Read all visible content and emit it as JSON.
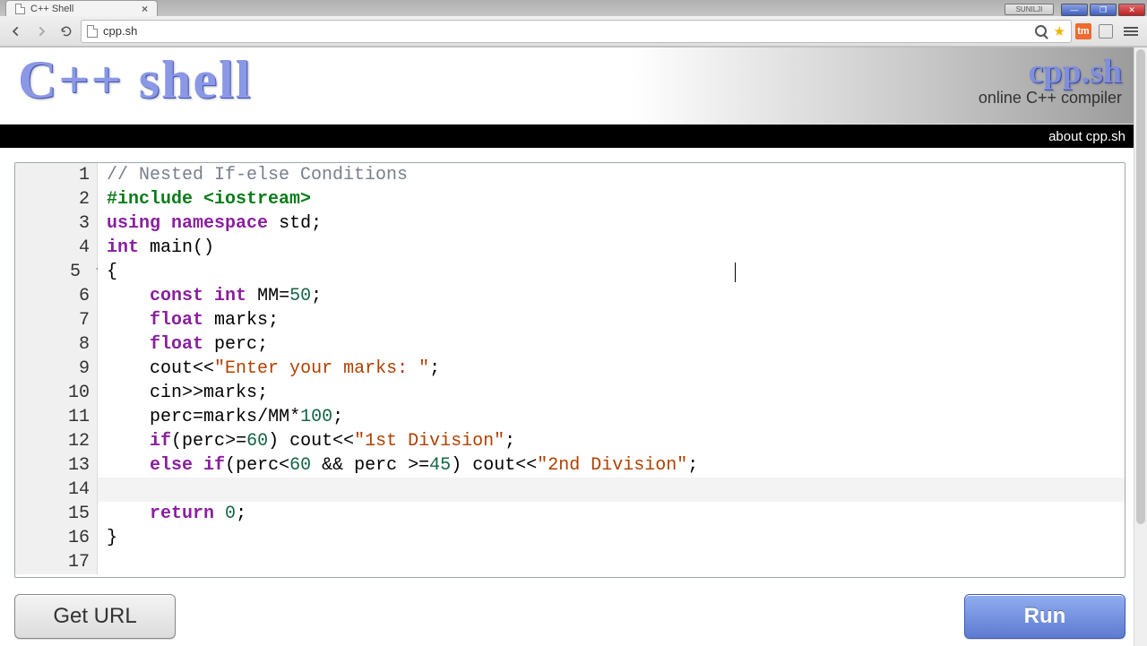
{
  "browser": {
    "tab_title": "C++ Shell",
    "url": "cpp.sh",
    "user_chip": "SUNILJI"
  },
  "header": {
    "logo_text": "C++ shell",
    "brand_title": "cpp.sh",
    "brand_subtitle": "online C++ compiler"
  },
  "nav": {
    "about": "about cpp.sh"
  },
  "editor": {
    "active_line": 14,
    "lines": [
      {
        "n": 1,
        "tokens": [
          [
            "comment",
            "// Nested If-else Conditions"
          ]
        ]
      },
      {
        "n": 2,
        "tokens": [
          [
            "macro",
            "#include"
          ],
          [
            "op",
            " "
          ],
          [
            "macro",
            "<iostream>"
          ]
        ]
      },
      {
        "n": 3,
        "tokens": [
          [
            "keyword",
            "using"
          ],
          [
            "op",
            " "
          ],
          [
            "keyword",
            "namespace"
          ],
          [
            "op",
            " "
          ],
          [
            "ident",
            "std"
          ],
          [
            "op",
            ";"
          ]
        ]
      },
      {
        "n": 4,
        "tokens": [
          [
            "type",
            "int"
          ],
          [
            "op",
            " "
          ],
          [
            "ident",
            "main"
          ],
          [
            "op",
            "()"
          ]
        ]
      },
      {
        "n": 5,
        "fold": true,
        "tokens": [
          [
            "op",
            "{"
          ]
        ]
      },
      {
        "n": 6,
        "indent": 1,
        "tokens": [
          [
            "keyword",
            "const"
          ],
          [
            "op",
            " "
          ],
          [
            "type",
            "int"
          ],
          [
            "op",
            " "
          ],
          [
            "ident",
            "MM"
          ],
          [
            "op",
            "="
          ],
          [
            "number",
            "50"
          ],
          [
            "op",
            ";"
          ]
        ]
      },
      {
        "n": 7,
        "indent": 1,
        "tokens": [
          [
            "type",
            "float"
          ],
          [
            "op",
            " "
          ],
          [
            "ident",
            "marks"
          ],
          [
            "op",
            ";"
          ]
        ]
      },
      {
        "n": 8,
        "indent": 1,
        "tokens": [
          [
            "type",
            "float"
          ],
          [
            "op",
            " "
          ],
          [
            "ident",
            "perc"
          ],
          [
            "op",
            ";"
          ]
        ]
      },
      {
        "n": 9,
        "indent": 1,
        "tokens": [
          [
            "ident",
            "cout"
          ],
          [
            "op",
            "<<"
          ],
          [
            "string",
            "\"Enter your marks: \""
          ],
          [
            "op",
            ";"
          ]
        ]
      },
      {
        "n": 10,
        "indent": 1,
        "tokens": [
          [
            "ident",
            "cin"
          ],
          [
            "op",
            ">>"
          ],
          [
            "ident",
            "marks"
          ],
          [
            "op",
            ";"
          ]
        ]
      },
      {
        "n": 11,
        "indent": 1,
        "tokens": [
          [
            "ident",
            "perc"
          ],
          [
            "op",
            "="
          ],
          [
            "ident",
            "marks"
          ],
          [
            "op",
            "/"
          ],
          [
            "ident",
            "MM"
          ],
          [
            "op",
            "*"
          ],
          [
            "number",
            "100"
          ],
          [
            "op",
            ";"
          ]
        ]
      },
      {
        "n": 12,
        "indent": 1,
        "tokens": [
          [
            "keyword",
            "if"
          ],
          [
            "op",
            "("
          ],
          [
            "ident",
            "perc"
          ],
          [
            "op",
            ">="
          ],
          [
            "number",
            "60"
          ],
          [
            "op",
            ") "
          ],
          [
            "ident",
            "cout"
          ],
          [
            "op",
            "<<"
          ],
          [
            "string",
            "\"1st Division\""
          ],
          [
            "op",
            ";"
          ]
        ]
      },
      {
        "n": 13,
        "indent": 1,
        "tokens": [
          [
            "keyword",
            "else"
          ],
          [
            "op",
            " "
          ],
          [
            "keyword",
            "if"
          ],
          [
            "op",
            "("
          ],
          [
            "ident",
            "perc"
          ],
          [
            "op",
            "<"
          ],
          [
            "number",
            "60"
          ],
          [
            "op",
            " && "
          ],
          [
            "ident",
            "perc"
          ],
          [
            "op",
            " >="
          ],
          [
            "number",
            "45"
          ],
          [
            "op",
            ") "
          ],
          [
            "ident",
            "cout"
          ],
          [
            "op",
            "<<"
          ],
          [
            "string",
            "\"2nd Division\""
          ],
          [
            "op",
            ";"
          ]
        ]
      },
      {
        "n": 14,
        "indent": 1,
        "tokens": []
      },
      {
        "n": 15,
        "indent": 1,
        "tokens": [
          [
            "keyword",
            "return"
          ],
          [
            "op",
            " "
          ],
          [
            "number",
            "0"
          ],
          [
            "op",
            ";"
          ]
        ]
      },
      {
        "n": 16,
        "tokens": [
          [
            "op",
            "}"
          ]
        ]
      },
      {
        "n": 17,
        "tokens": []
      }
    ]
  },
  "buttons": {
    "get_url": "Get URL",
    "run": "Run"
  }
}
